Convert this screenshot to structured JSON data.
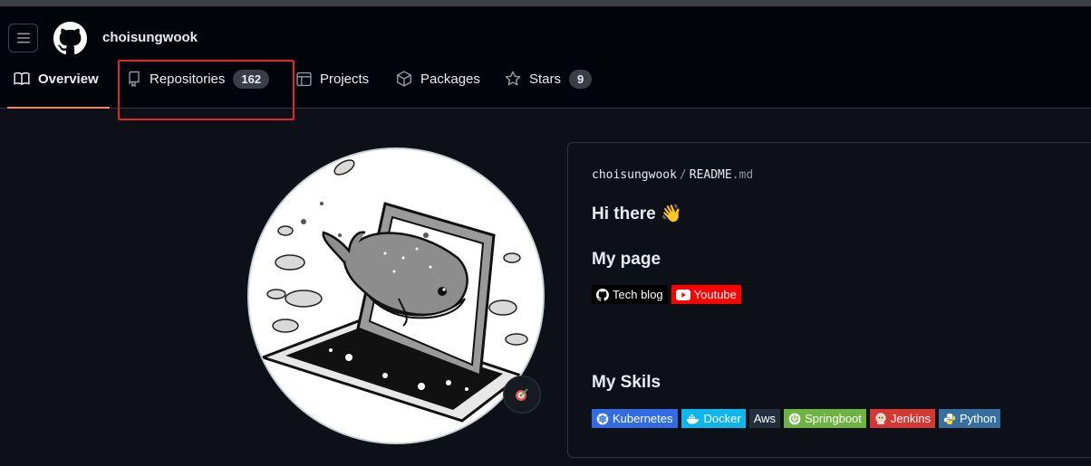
{
  "header": {
    "username": "choisungwook",
    "tabs": [
      {
        "label": "Overview"
      },
      {
        "label": "Repositories",
        "count": "162"
      },
      {
        "label": "Projects"
      },
      {
        "label": "Packages"
      },
      {
        "label": "Stars",
        "count": "9"
      }
    ]
  },
  "readme": {
    "path_owner": "choisungwook",
    "path_separator": "/",
    "path_file": "README",
    "path_ext": ".md",
    "greeting": "Hi there 👋",
    "my_page_heading": "My page",
    "page_badges": [
      {
        "label": "Tech blog",
        "color": "#000000",
        "icon": "github-icon"
      },
      {
        "label": "Youtube",
        "color": "#ff0000",
        "icon": "youtube-icon"
      }
    ],
    "skills_heading": "My Skils",
    "skill_badges": [
      {
        "label": "Kubernetes",
        "color": "#326ce5",
        "icon": "kubernetes-icon"
      },
      {
        "label": "Docker",
        "color": "#0db7ed",
        "icon": "docker-icon"
      },
      {
        "label": "Aws",
        "color": "#232f3e",
        "icon": ""
      },
      {
        "label": "Springboot",
        "color": "#6db33f",
        "icon": "spring-icon"
      },
      {
        "label": "Jenkins",
        "color": "#d33833",
        "icon": "jenkins-icon"
      },
      {
        "label": "Python",
        "color": "#3670a0",
        "icon": "python-icon"
      }
    ]
  },
  "colors": {
    "accent_underline": "#f78166",
    "highlight_box": "#e5222f",
    "background": "#0d1117"
  }
}
